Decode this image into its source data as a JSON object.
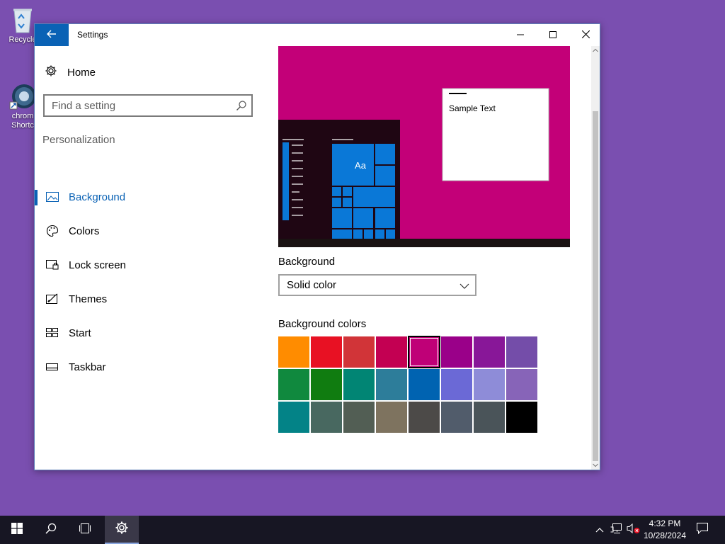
{
  "desktop": {
    "icons": [
      {
        "label": "Recycle",
        "icon": "recycle-bin-icon"
      },
      {
        "label_line1": "chrom",
        "label_line2": "Shortc",
        "icon": "chrome-icon"
      }
    ]
  },
  "window": {
    "title": "Settings",
    "caption_buttons": [
      "minimize-icon",
      "maximize-icon",
      "close-icon"
    ]
  },
  "sidebar": {
    "home_label": "Home",
    "search_placeholder": "Find a setting",
    "section_title": "Personalization",
    "items": [
      {
        "label": "Background",
        "icon": "picture-icon",
        "active": true
      },
      {
        "label": "Colors",
        "icon": "palette-icon",
        "active": false
      },
      {
        "label": "Lock screen",
        "icon": "lock-screen-icon",
        "active": false
      },
      {
        "label": "Themes",
        "icon": "themes-icon",
        "active": false
      },
      {
        "label": "Start",
        "icon": "start-icon",
        "active": false
      },
      {
        "label": "Taskbar",
        "icon": "taskbar-icon",
        "active": false
      }
    ]
  },
  "preview": {
    "sample_text": "Sample Text",
    "tile_text": "Aa",
    "background_color": "#c30078",
    "accent_color": "#0a78d7"
  },
  "background": {
    "label": "Background",
    "selected_value": "Solid color"
  },
  "background_colors": {
    "label": "Background colors",
    "selected_index": 4,
    "colors": [
      "#ff8c00",
      "#e81123",
      "#d13438",
      "#c30052",
      "#bf0077",
      "#9a0089",
      "#881798",
      "#744da9",
      "#10893e",
      "#107c10",
      "#018574",
      "#2d7d9a",
      "#0063b1",
      "#6b69d6",
      "#8e8cd8",
      "#8764b8",
      "#038387",
      "#486860",
      "#525e54",
      "#7e735f",
      "#4c4a48",
      "#515c6b",
      "#4a5459",
      "#000000"
    ]
  },
  "taskbar": {
    "buttons": [
      "windows-start-icon",
      "search-icon",
      "task-view-icon",
      "settings-gear-icon"
    ],
    "time": "4:32 PM",
    "date": "10/28/2024"
  }
}
